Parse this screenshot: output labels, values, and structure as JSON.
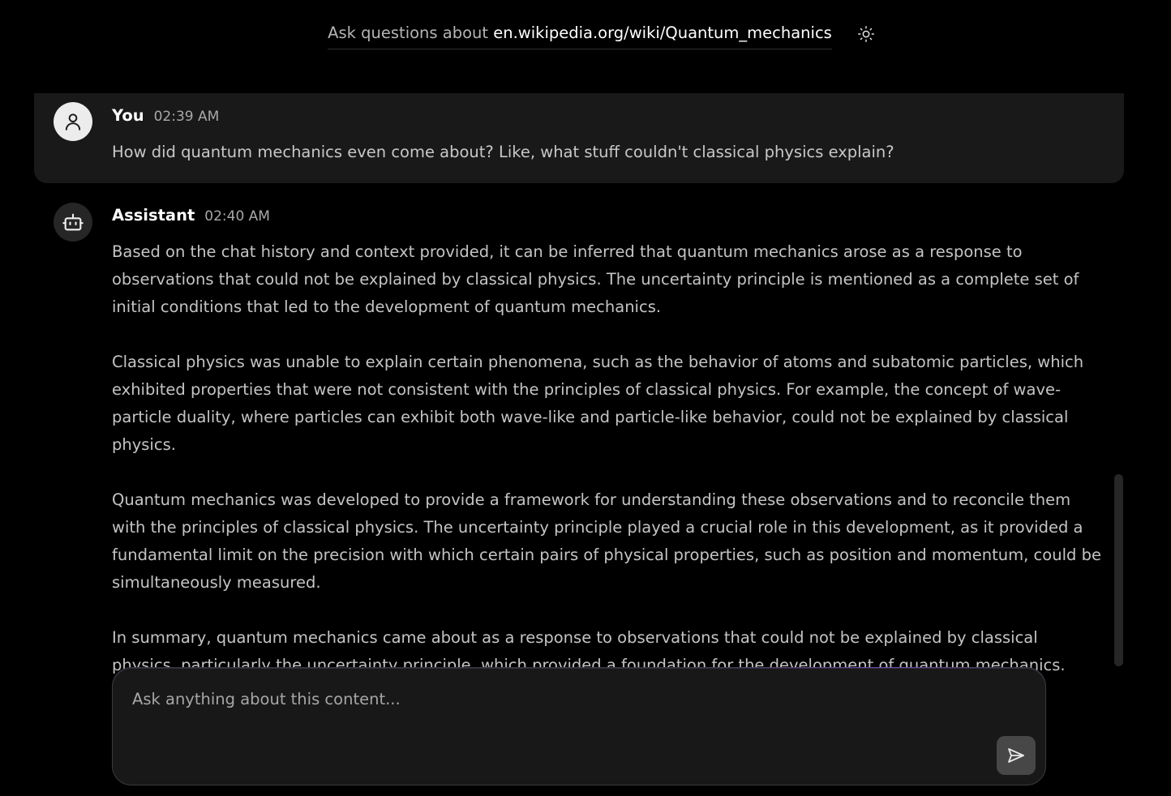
{
  "header": {
    "prefix": "Ask questions about ",
    "url": "en.wikipedia.org/wiki/Quantum_mechanics",
    "theme_icon": "sun-icon"
  },
  "messages": {
    "user": {
      "name": "You",
      "time": "02:39 AM",
      "text": "How did quantum mechanics even come about? Like, what stuff couldn't classical physics explain?",
      "avatar_icon": "user-icon"
    },
    "assistant": {
      "name": "Assistant",
      "time": "02:40 AM",
      "avatar_icon": "robot-icon",
      "paragraphs": [
        "Based on the chat history and context provided, it can be inferred that quantum mechanics arose as a response to observations that could not be explained by classical physics. The uncertainty principle is mentioned as a complete set of initial conditions that led to the development of quantum mechanics.",
        "Classical physics was unable to explain certain phenomena, such as the behavior of atoms and subatomic particles, which exhibited properties that were not consistent with the principles of classical physics. For example, the concept of wave-particle duality, where particles can exhibit both wave-like and particle-like behavior, could not be explained by classical physics.",
        "Quantum mechanics was developed to provide a framework for understanding these observations and to reconcile them with the principles of classical physics. The uncertainty principle played a crucial role in this development, as it provided a fundamental limit on the precision with which certain pairs of physical properties, such as position and momentum, could be simultaneously measured.",
        "In summary, quantum mechanics came about as a response to observations that could not be explained by classical physics, particularly the uncertainty principle, which provided a foundation for the development of quantum mechanics."
      ]
    }
  },
  "composer": {
    "placeholder": "Ask anything about this content...",
    "value": "",
    "send_icon": "send-icon"
  },
  "colors": {
    "background": "#000000",
    "user_bubble": "#191919",
    "composer_bg": "#181818",
    "send_button": "#474747",
    "accent_glow": "#6b4fa6"
  }
}
